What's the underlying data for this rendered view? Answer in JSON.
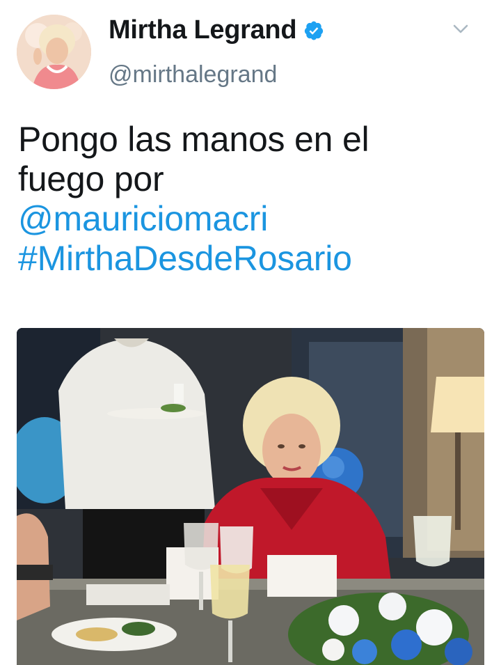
{
  "tweet": {
    "author": {
      "display_name": "Mirtha Legrand",
      "handle": "@mirthalegrand",
      "verified": true,
      "verified_icon": "verified-badge-icon",
      "avatar_icon": "profile-avatar"
    },
    "menu_icon": "chevron-down-icon",
    "text_lines": [
      "Pongo las manos en el",
      "fuego por"
    ],
    "mention": "@mauriciomacri",
    "hashtag": "#MirthaDesdeRosario",
    "media": {
      "type": "photo",
      "icon": "photo"
    }
  },
  "colors": {
    "link": "#1b95e0",
    "text": "#14171a",
    "secondary": "#657786",
    "verified_badge": "#1da1f2"
  }
}
